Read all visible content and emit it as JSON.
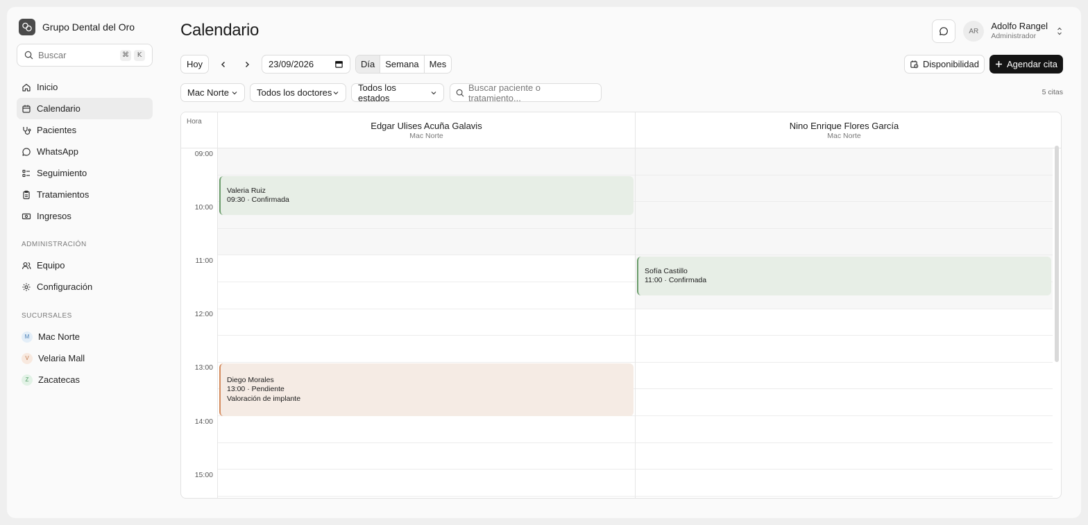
{
  "app": {
    "brand": "Grupo Dental del Oro",
    "search_placeholder": "Buscar",
    "shortcut": [
      "⌘",
      "K"
    ]
  },
  "sidebar": {
    "items": [
      {
        "label": "Inicio",
        "icon": "home-icon"
      },
      {
        "label": "Calendario",
        "icon": "calendar-icon",
        "active": true
      },
      {
        "label": "Pacientes",
        "icon": "stethoscope-icon"
      },
      {
        "label": "WhatsApp",
        "icon": "message-icon"
      },
      {
        "label": "Seguimiento",
        "icon": "list-check-icon"
      },
      {
        "label": "Tratamientos",
        "icon": "clipboard-icon"
      },
      {
        "label": "Ingresos",
        "icon": "banknote-icon"
      }
    ],
    "admin_label": "ADMINISTRACIÓN",
    "admin_items": [
      {
        "label": "Equipo",
        "icon": "users-icon"
      },
      {
        "label": "Configuración",
        "icon": "gear-icon"
      }
    ],
    "branches_label": "SUCURSALES",
    "branches": [
      {
        "initial": "M",
        "label": "Mac Norte",
        "bg": "#e3eef8",
        "fg": "#4a7fb5"
      },
      {
        "initial": "V",
        "label": "Velaria Mall",
        "bg": "#f8e9df",
        "fg": "#c07a4f"
      },
      {
        "initial": "Z",
        "label": "Zacatecas",
        "bg": "#e2f2e6",
        "fg": "#4f9a63"
      }
    ]
  },
  "header": {
    "title": "Calendario",
    "user": {
      "initials": "AR",
      "name": "Adolfo Rangel",
      "role": "Administrador"
    }
  },
  "toolbar": {
    "today": "Hoy",
    "date": "23/09/2026",
    "views": [
      {
        "label": "Día",
        "active": true
      },
      {
        "label": "Semana"
      },
      {
        "label": "Mes"
      }
    ],
    "availability": "Disponibilidad",
    "schedule": "Agendar cita"
  },
  "filters": {
    "branch": "Mac Norte",
    "doctors": "Todos los doctores",
    "states": "Todos los estados",
    "search_placeholder": "Buscar paciente o tratamiento...",
    "count": "5 citas"
  },
  "calendar": {
    "hour_label": "Hora",
    "hours": [
      "09:00",
      "10:00",
      "11:00",
      "12:00",
      "13:00",
      "14:00",
      "15:00"
    ],
    "doctors": [
      {
        "name": "Edgar Ulises Acuña Galavis",
        "branch": "Mac Norte"
      },
      {
        "name": "Nino Enrique Flores García",
        "branch": "Mac Norte"
      }
    ],
    "appointments": [
      {
        "doctor": 0,
        "patient": "Valeria Ruiz",
        "detail": "09:30 · Confirmada",
        "note": "",
        "color": "green"
      },
      {
        "doctor": 1,
        "patient": "Sofía Castillo",
        "detail": "11:00 · Confirmada",
        "note": "",
        "color": "green"
      },
      {
        "doctor": 0,
        "patient": "Diego Morales",
        "detail": "13:00 · Pendiente",
        "note": "Valoración de implante",
        "color": "orange"
      }
    ]
  }
}
